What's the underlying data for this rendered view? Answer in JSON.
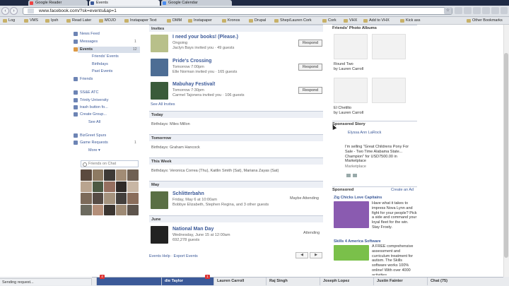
{
  "browser": {
    "tabs": [
      "Google Reader",
      "Events",
      "Google Calendar"
    ],
    "url": "www.facebook.com/?sk=events&ap=1",
    "bookmarks": [
      "Log",
      "VMS",
      "Ipsh",
      "Read Later",
      "MOJO",
      "Instapaper Text",
      "DMM",
      "Instapaper",
      "Kronos",
      "Drupal",
      "Shep/Lauren Cork",
      "Cork",
      "VHX",
      "Add to VHX",
      "Kick ass"
    ],
    "other_bookmarks": "Other Bookmarks"
  },
  "left_nav": {
    "items": [
      {
        "label": "News Feed"
      },
      {
        "label": "Messages",
        "count": "1"
      },
      {
        "label": "Events",
        "count": "12"
      }
    ],
    "event_sub": [
      "Friends' Events",
      "Birthdays",
      "Past Events"
    ],
    "friends": "Friends",
    "groups": [
      "SS&E ATC",
      "Trinity University",
      "trash button fo...",
      "Create Group..."
    ],
    "see_all": "See All",
    "apps": [
      {
        "label": "BizGreet Spurs"
      },
      {
        "label": "Game Requests",
        "count": "1"
      }
    ],
    "more": "More ▾",
    "friends_on_chat": "Friends on Chat"
  },
  "main": {
    "invites_header": "Invites",
    "invites": [
      {
        "title": "I need your books! (Please.)",
        "line1": "Ongoing",
        "line2": "Jaclyn Bays invited you · 49 guests",
        "button": "Respond"
      },
      {
        "title": "Pride's Crossing",
        "line1": "Tomorrow 7:00pm",
        "line2": "Elle Norman invited you · 165 guests",
        "button": "Respond"
      },
      {
        "title": "Mabuhay Festival!",
        "line1": "Tomorrow 7:30pm",
        "line2": "Carmel Tajonera invited you · 106 guests",
        "button": "Respond"
      }
    ],
    "see_all_invites": "See All Invites",
    "today_header": "Today",
    "today_text": "Birthdays: Miles Millon",
    "tomorrow_header": "Tomorrow",
    "tomorrow_text": "Birthdays: Graham Hancock",
    "week_header": "This Week",
    "week_text": "Birthdays: Veronica Correa (Thu), Kaitlin Smith (Sat), Mariana Zayas (Sat)",
    "may_header": "May",
    "may_event": {
      "title": "Schlitterbahn",
      "line1": "Friday, May 6 at 10:00am",
      "line2": "Bobbye Elizabeth, Stephen Regina, and 3 other guests",
      "status": "Maybe Attending"
    },
    "june_header": "June",
    "june_event": {
      "title": "National Man Day",
      "line1": "Wednesday, June 15 at 12:00am",
      "line2": "692,278 guests",
      "status": "Attending"
    },
    "footer": "Events Help · Export Events",
    "prev": "◀",
    "next": "▶"
  },
  "right_col": {
    "albums_header": "Friends' Photo Albums",
    "albums": [
      {
        "title": "Round Two",
        "by": "by Lauren Carroll"
      },
      {
        "title": "El Chetilto",
        "by": "by Lauren Carroll"
      }
    ],
    "sponsored_story_header": "Sponsored Story",
    "story_name": "Elyssa Ann LaRock",
    "story_text": "I'm selling \"Great Childrens Pony For Sale - Two Time Alabama State... Champion\" for USD7500.00 in Marketplace",
    "story_source": "Marketplace",
    "sponsored_header": "Sponsored",
    "create_ad": "Create an Ad",
    "ad1_title": "Zig Chicks Love Capitains",
    "ad1_text": "Have what it takes to impress Nova Lynn and fight for your people? Pick a side and command your loyal fleet for the win. Stay Frosty.",
    "ad2_title": "Skills 4 America Software",
    "ad2_text": "A FREE comprehensive assessment and curriculum treatment for autism. The Skills software works 100% online! With over 4000 activities."
  },
  "chat": {
    "tabs": [
      "die Taylor",
      "Lauren Carroll",
      "Raj Singh",
      "Joseph Lopez",
      "Justin Fainter",
      "Chat (75)"
    ],
    "badges": [
      "4",
      "1"
    ]
  },
  "status": "Sending request..."
}
